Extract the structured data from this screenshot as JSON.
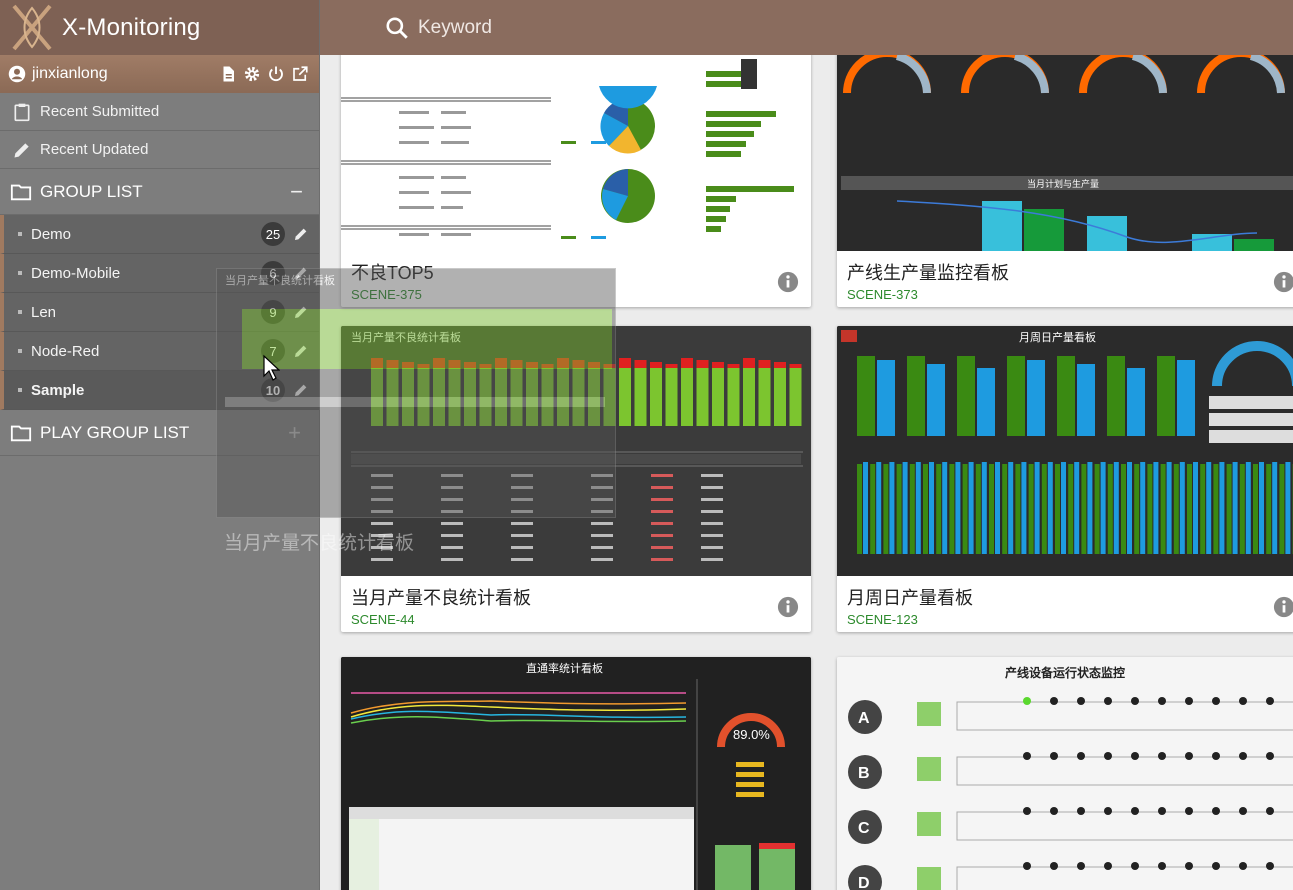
{
  "app": {
    "title": "X-Monitoring"
  },
  "user": {
    "name": "jinxianlong"
  },
  "nav": {
    "recent_submitted": "Recent Submitted",
    "recent_updated": "Recent Updated"
  },
  "group_list": {
    "title": "GROUP LIST",
    "collapse_symbol": "−",
    "items": [
      {
        "label": "Demo",
        "count": "25"
      },
      {
        "label": "Demo-Mobile",
        "count": "6"
      },
      {
        "label": "Len",
        "count": "9"
      },
      {
        "label": "Node-Red",
        "count": "7"
      },
      {
        "label": "Sample",
        "count": "10"
      }
    ]
  },
  "play_group_list": {
    "title": "PLAY GROUP LIST",
    "add_symbol": "+"
  },
  "search": {
    "placeholder": "Keyword"
  },
  "drag_ghost": {
    "title": "当月产量不良统计看板",
    "thumb_title": "当月产量不良统计看板"
  },
  "cards": [
    {
      "title": "不良TOP5",
      "scene": "SCENE-375"
    },
    {
      "title": "产线生产量监控看板",
      "scene": "SCENE-373",
      "thumb_title": "当月计划与生产量"
    },
    {
      "title": "当月产量不良统计看板",
      "scene": "SCENE-44",
      "thumb_title": "当月产量不良统计看板"
    },
    {
      "title": "月周日产量看板",
      "scene": "SCENE-123",
      "thumb_title": "月周日产量看板"
    },
    {
      "title": "",
      "scene": "",
      "thumb_title": "直通率统计看板",
      "gauge_value": "89.0%"
    },
    {
      "title": "",
      "scene": "",
      "thumb_title": "产线设备运行状态监控",
      "units": [
        "A",
        "B",
        "C",
        "D"
      ]
    }
  ],
  "colors": {
    "brand": "#7e6154",
    "topbar": "#8a6c5e",
    "sidebar": "#7d7d7d",
    "scene": "#2d8a2d"
  }
}
